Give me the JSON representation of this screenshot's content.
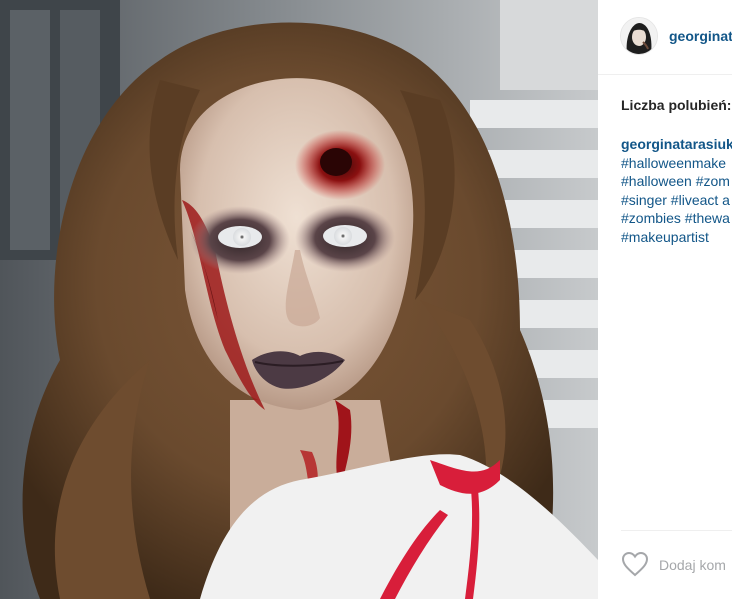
{
  "post": {
    "username": "georginat",
    "likes_label": "Liczba polubień:",
    "caption": {
      "author": "georginatarasiuk",
      "lines": [
        "#halloweenmake",
        "#halloween #zom",
        "#singer #liveact a",
        "#zombies #thewa",
        "#makeupartist"
      ]
    },
    "comment_placeholder": "Dodaj kom"
  },
  "icons": {
    "like": "heart-outline-icon"
  },
  "colors": {
    "link": "#125688",
    "text": "#262626",
    "divider": "#efefef",
    "placeholder": "#a5a7aa"
  }
}
